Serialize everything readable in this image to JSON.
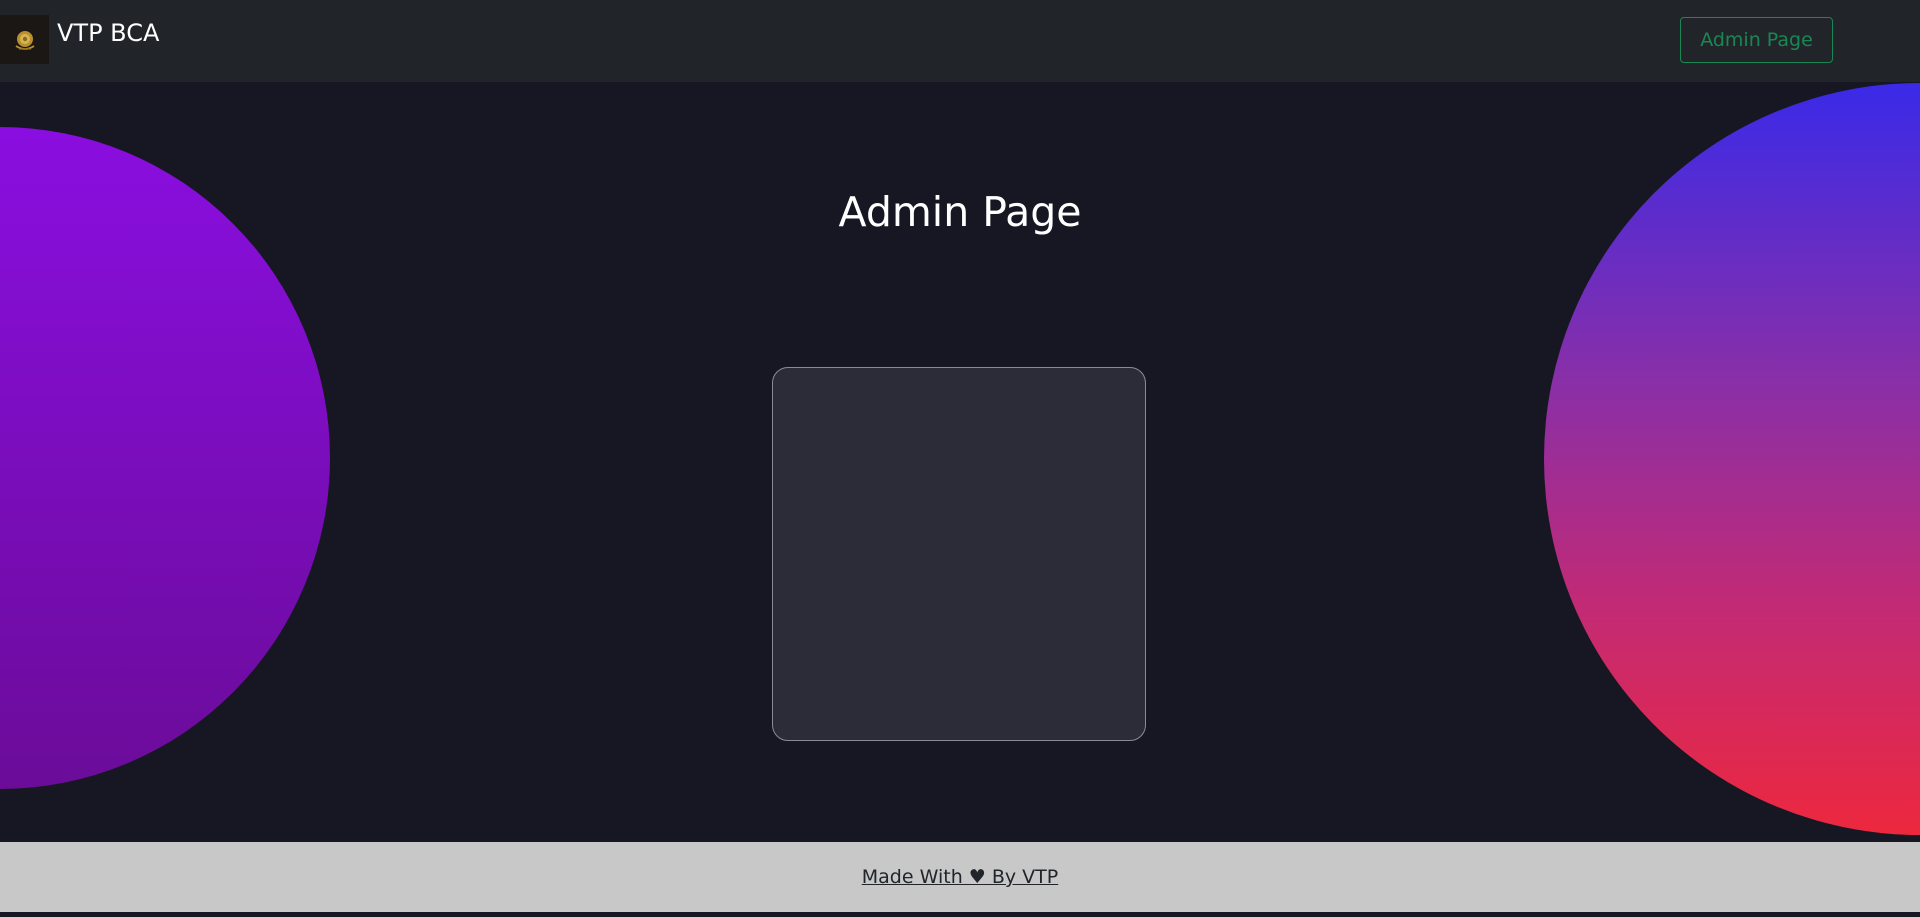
{
  "navbar": {
    "brand_name": "VTP BCA",
    "admin_button_label": "Admin Page",
    "logo_icon": "emblem-icon"
  },
  "main": {
    "title": "Admin Page"
  },
  "footer": {
    "link_text": "Made With ♥ By VTP"
  },
  "colors": {
    "background": "#161722",
    "navbar": "#212529",
    "accent_green": "#198754",
    "card": "#2b2c38",
    "footer": "#c8c8c8",
    "left_circle_gradient": [
      "#8a0ee0",
      "#6b0c99"
    ],
    "right_circle_gradient": [
      "#3a2ae8",
      "#8a2fa7",
      "#c32a74",
      "#ed283e"
    ]
  }
}
